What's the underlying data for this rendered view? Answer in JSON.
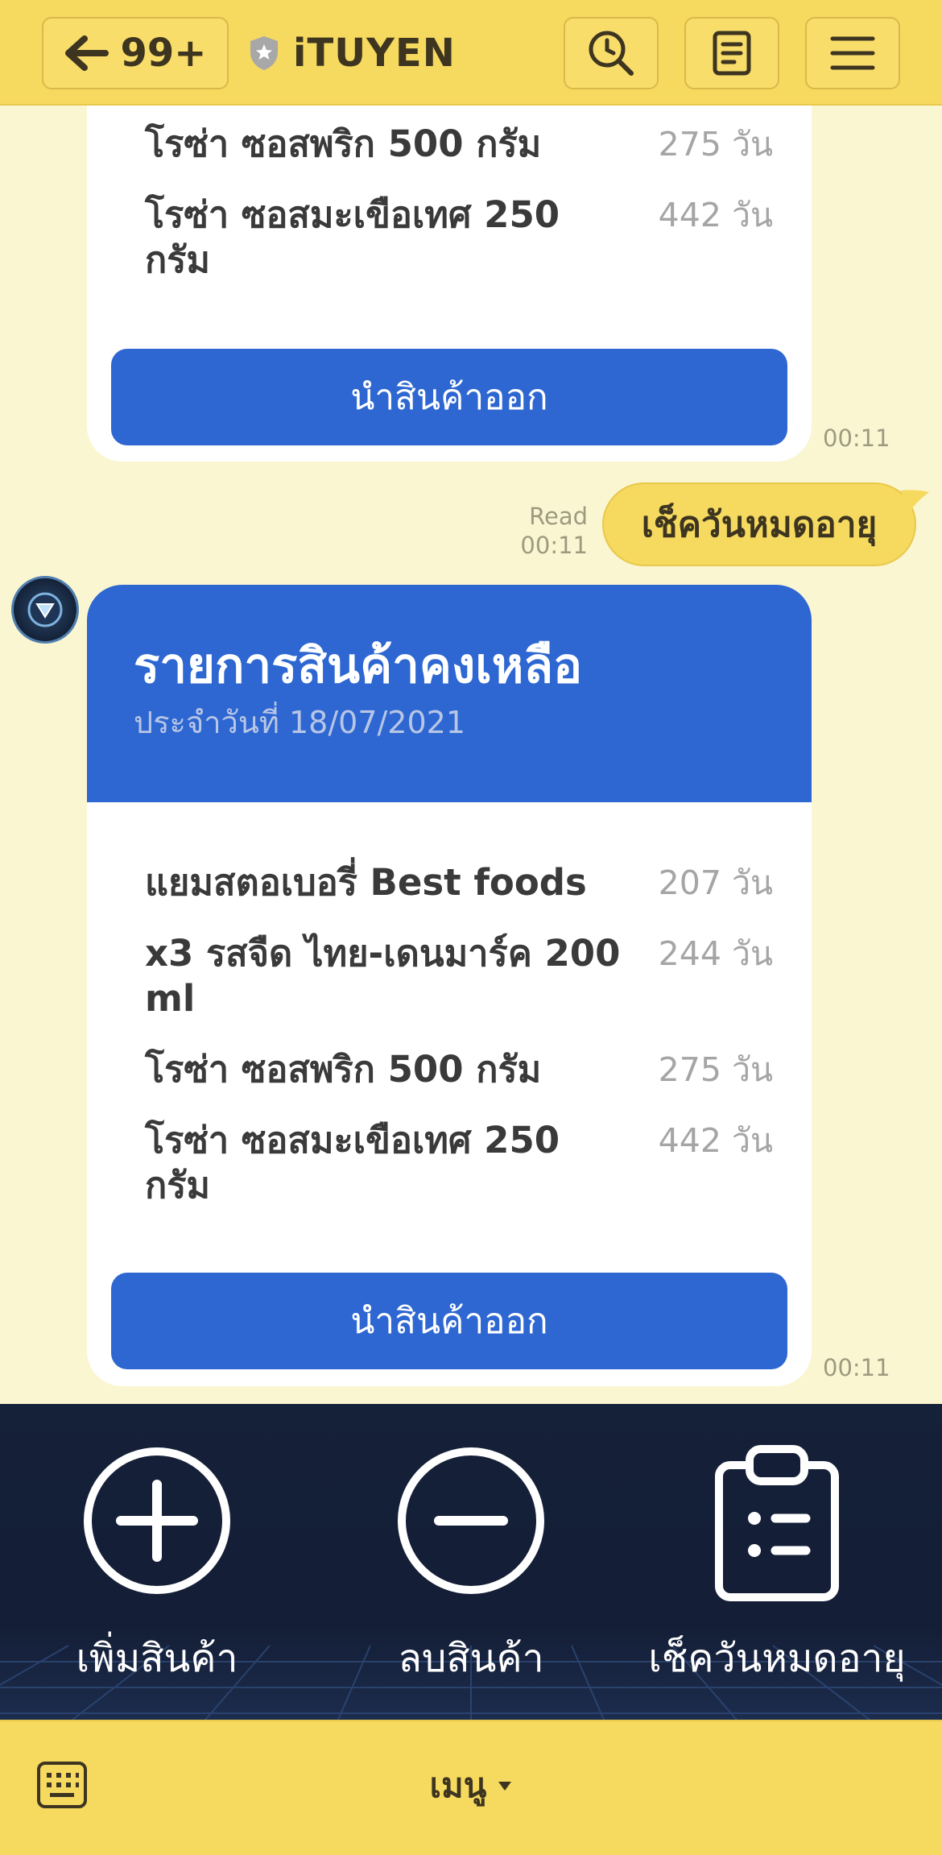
{
  "header": {
    "back_count": "99+",
    "brand_name": "iTUYEN"
  },
  "card_top": {
    "items": [
      {
        "name": "โรซ่า ซอสพริก 500 กรัม",
        "days": "275 วัน"
      },
      {
        "name": "โรซ่า ซอสมะเขือเทศ 250 กรัม",
        "days": "442 วัน"
      }
    ],
    "button_label": "นำสินค้าออก",
    "time": "00:11"
  },
  "user_message": {
    "text": "เช็ควันหมดอายุ",
    "read_label": "Read",
    "time": "00:11"
  },
  "card_main": {
    "title": "รายการสินค้าคงเหลือ",
    "subtitle": "ประจำวันที่ 18/07/2021",
    "items": [
      {
        "name": "แยมสตอเบอรี่ Best foods",
        "days": "207 วัน"
      },
      {
        "name": "x3 รสจืด ไทย-เดนมาร์ค 200 ml",
        "days": "244 วัน"
      },
      {
        "name": "โรซ่า ซอสพริก 500 กรัม",
        "days": "275 วัน"
      },
      {
        "name": "โรซ่า ซอสมะเขือเทศ 250 กรัม",
        "days": "442 วัน"
      }
    ],
    "button_label": "นำสินค้าออก",
    "time": "00:11"
  },
  "rich_menu": {
    "items": [
      {
        "label": "เพิ่มสินค้า",
        "icon": "plus-circle-icon"
      },
      {
        "label": "ลบสินค้า",
        "icon": "minus-circle-icon"
      },
      {
        "label": "เช็ควันหมดอายุ",
        "icon": "clipboard-list-icon"
      }
    ]
  },
  "bottom_bar": {
    "menu_label": "เมนู"
  },
  "colors": {
    "header_yellow": "#F6D95F",
    "chat_background": "#FBF6D2",
    "card_blue": "#2E67D1",
    "rich_menu_navy": "#141E36"
  }
}
